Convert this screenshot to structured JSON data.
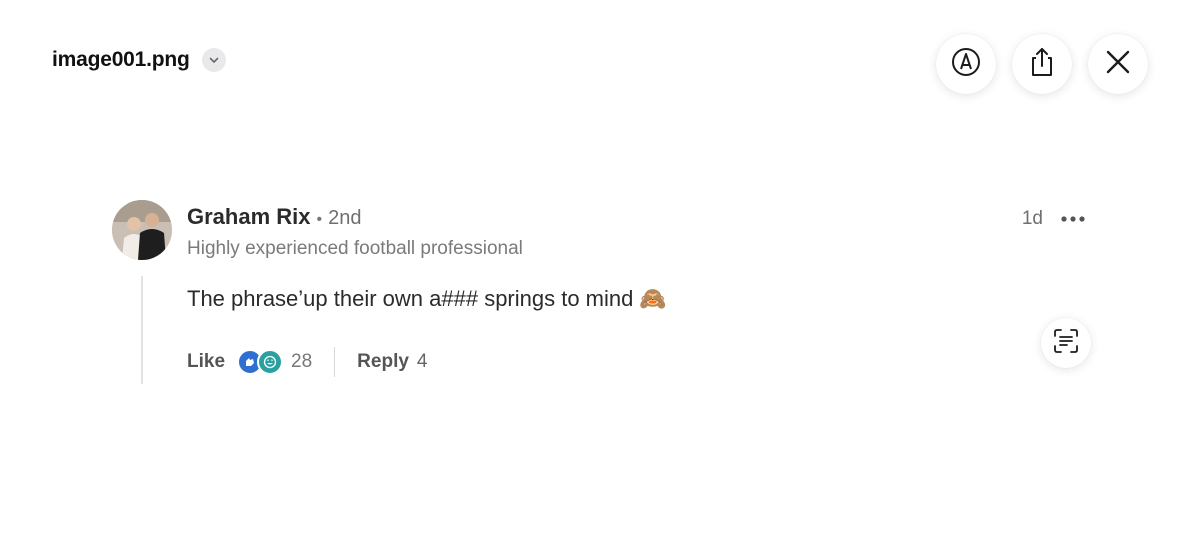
{
  "header": {
    "filename": "image001.png",
    "filename_menu_icon": "chevron-down-icon"
  },
  "toolbar": {
    "markup_icon": "markup-pen-icon",
    "share_icon": "share-icon",
    "close_icon": "close-icon"
  },
  "comment": {
    "author": "Graham Rix",
    "separator": "•",
    "degree": "2nd",
    "headline": "Highly experienced football professional",
    "time": "1d",
    "more_icon": "ellipsis-icon",
    "text": "The phrase’up their own a### springs to mind",
    "emoji": "🙈",
    "like_label": "Like",
    "reaction_icons": [
      "clap-icon",
      "laugh-icon"
    ],
    "reaction_count": "28",
    "reply_label": "Reply",
    "reply_count": "4"
  },
  "live_text_icon": "live-text-icon",
  "colors": {
    "clap": "#2f6fd1",
    "laugh": "#2aa0a0"
  }
}
